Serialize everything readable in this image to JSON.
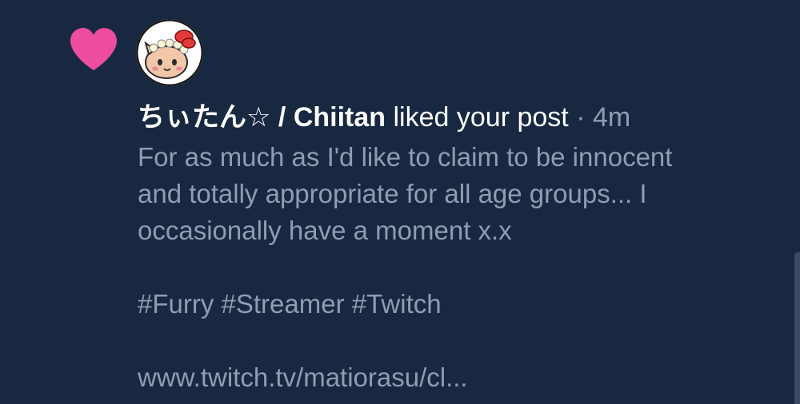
{
  "notification": {
    "author": "ちぃたん☆ / Chiitan",
    "action": "liked your post",
    "separator": "·",
    "time": "4m",
    "heart_color": "#ec4d9e",
    "avatar_icon": "chiitan-avatar-icon"
  },
  "post": {
    "lines": [
      "For as much as I'd like to claim to be innocent",
      "and totally appropriate for all age groups... I",
      "occasionally have a moment x.x"
    ],
    "hashtags": "#Furry #Streamer #Twitch",
    "link": "www.twitch.tv/matiorasu/cl..."
  },
  "colors": {
    "background": "#182840",
    "primary_text": "#ffffff",
    "secondary_text": "#8d9db3"
  }
}
